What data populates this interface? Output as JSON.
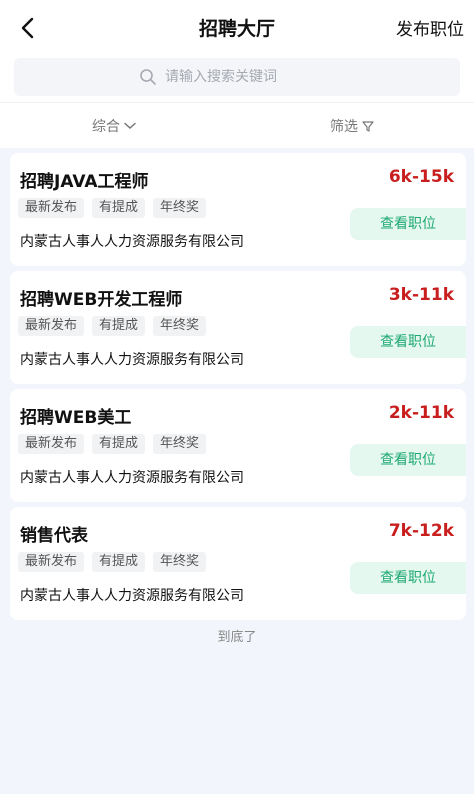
{
  "header": {
    "title": "招聘大厅",
    "publish_label": "发布职位"
  },
  "search": {
    "placeholder": "请输入搜索关键词"
  },
  "filters": {
    "sort_label": "综合",
    "screen_label": "筛选"
  },
  "jobs": [
    {
      "title": "招聘JAVA工程师",
      "salary": "6k-15k",
      "tags": [
        "最新发布",
        "有提成",
        "年终奖"
      ],
      "company": "内蒙古人事人人力资源服务有限公司",
      "action": "查看职位"
    },
    {
      "title": "招聘WEB开发工程师",
      "salary": "3k-11k",
      "tags": [
        "最新发布",
        "有提成",
        "年终奖"
      ],
      "company": "内蒙古人事人人力资源服务有限公司",
      "action": "查看职位"
    },
    {
      "title": "招聘WEB美工",
      "salary": "2k-11k",
      "tags": [
        "最新发布",
        "有提成",
        "年终奖"
      ],
      "company": "内蒙古人事人人力资源服务有限公司",
      "action": "查看职位"
    },
    {
      "title": "销售代表",
      "salary": "7k-12k",
      "tags": [
        "最新发布",
        "有提成",
        "年终奖"
      ],
      "company": "内蒙古人事人人力资源服务有限公司",
      "action": "查看职位"
    }
  ],
  "footer": {
    "end_text": "到底了"
  },
  "colors": {
    "salary": "#c81e1e",
    "action_text": "#1ea873",
    "action_bg": "#e5f8f0",
    "page_bg": "#f2f5fb"
  },
  "icons": {
    "back": "chevron-left-icon",
    "search": "search-icon",
    "sort": "chevron-down-icon",
    "screen": "funnel-icon"
  }
}
